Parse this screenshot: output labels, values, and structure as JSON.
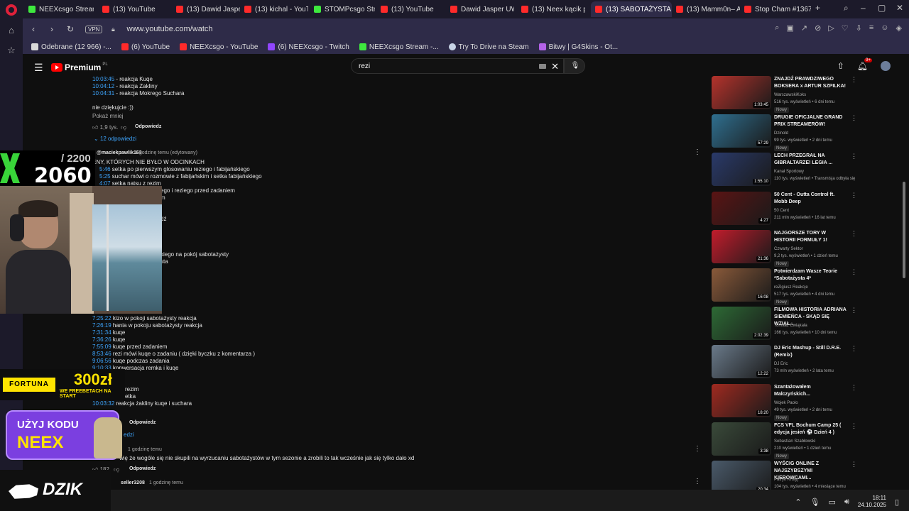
{
  "browser": {
    "tabs": [
      {
        "label": "NEEXcsgo Stream - W",
        "icon": "kick"
      },
      {
        "label": "(13) YouTube",
        "icon": "yt"
      },
      {
        "label": "(13) Dawid Jasper UW",
        "icon": "yt"
      },
      {
        "label": "(13) kichal - YouTube",
        "icon": "yt"
      },
      {
        "label": "STOMPcsgo Strea",
        "icon": "kick"
      },
      {
        "label": "(13) YouTube",
        "icon": "yt"
      },
      {
        "label": "Dawid Jasper UWIEL",
        "icon": "yt"
      },
      {
        "label": "(13) Neex kącik piłka",
        "icon": "yt"
      },
      {
        "label": "(13) SABOTAŻYSTA 4",
        "icon": "yt"
      },
      {
        "label": "(13) Mamm0n– Aman",
        "icon": "yt"
      },
      {
        "label": "Stop Cham #1367 - N",
        "icon": "yt"
      }
    ],
    "new_tab": "+",
    "vpn": "VPN",
    "url": "www.youtube.com/watch",
    "bookmarks": [
      {
        "label": "Odebrane (12 966) -...",
        "icon": "mail"
      },
      {
        "label": "(6) YouTube",
        "icon": "yt"
      },
      {
        "label": "NEEXcsgo - YouTube",
        "icon": "yt"
      },
      {
        "label": "(6) NEEXcsgo - Twitch",
        "icon": "twitch"
      },
      {
        "label": "NEEXcsgo Stream -...",
        "icon": "kick"
      },
      {
        "label": "Try To Drive na Steam",
        "icon": "steam"
      },
      {
        "label": "Bitwy | G4Skins - Ot...",
        "icon": "g4"
      }
    ]
  },
  "youtube": {
    "logo_word": "Premium",
    "logo_region": "PL",
    "search_value": "rezi",
    "notif_count": "9+"
  },
  "comments": {
    "lines_top": [
      {
        "ts": "10:03:45",
        "text": " - reakcja Kuqe"
      },
      {
        "ts": "10:04:12",
        "text": " - reakcja Zakliny"
      },
      {
        "ts": "10:04:31",
        "text": " - reakcja Mokrego Suchara"
      }
    ],
    "body1": "nie dziękujcie :))",
    "show_less": "Pokaż mniej",
    "likes1": "1,9 tys.",
    "reply": "Odpowiedz",
    "replies_toggle": "12 odpowiedzi",
    "author2": "@maciekpawlik163",
    "meta2": "1 godzinę temu (edytowany)",
    "header2": "ENY, KTÓRYCH NIE BYŁO W ODCINKACH",
    "lines_mid": [
      {
        "ts": "5:46",
        "text": " setka po pierwszym glosowaniu reziego i fabijańskiego"
      },
      {
        "ts": "5:25",
        "text": " suchar mówi o rozmowie z fabijańskim i setka fabijańskiego"
      },
      {
        "ts": "4:07",
        "text": " setka natsu z rezim"
      }
    ],
    "frag1": "ego i reziego przed zadaniem",
    "frag2": "m",
    "frag3": "dź",
    "frag4": "kiego na pokój sabotażysty",
    "frag5": "sta",
    "lines_low": [
      {
        "ts": "7:25:22",
        "text": " kizo w pokoji sabotażysty reakcja"
      },
      {
        "ts": "7:26:19",
        "text": " hania w pokoju sabotażysty reakcja"
      },
      {
        "ts": "7:31:34",
        "text": " kuqe"
      },
      {
        "ts": "7:36:26",
        "text": " kuqe"
      },
      {
        "ts": "7:55:09",
        "text": " kuqe przed zadaniem"
      },
      {
        "ts": "8:53:46",
        "text": " rezi mówi kuqe o zadaniu ( dzięki byczku z komentarza )"
      },
      {
        "ts": "9:06:56",
        "text": " kuqe podczas zadania"
      },
      {
        "ts": "9:10:33",
        "text": " konwersacja remka i kuqe"
      }
    ],
    "frag6": "rezim",
    "frag7": "etka",
    "line_last": {
      "ts": "10:03:32",
      "text": " reakcja żakliny kuqe i suchara"
    },
    "reply_b": "Odpowiedz",
    "frag8": "edzi",
    "meta3": "1 godzinę temu",
    "body3": "wię że wogóle się nie skupili na wyrzucaniu sabotażystów w tym sezonie a zrobili to tak wcześnie jak się tylko dało xd",
    "likes3": "182",
    "reply_c": "Odpowiedz",
    "author4": "seller3208",
    "meta4": "1 godzinę temu"
  },
  "overlay": {
    "counter_total": "/ 2200",
    "counter_value": "2060",
    "fortuna_brand": "FORTUNA",
    "fortuna_amount": "300zł",
    "fortuna_note": "WE FREEBETACH NA START",
    "code_line1": "UŻYJ KODU",
    "code_line2": "NEEX",
    "dzik_word": "DZIK"
  },
  "recommendations": [
    {
      "title": "ZNAJDŹ PRAWDZIWEGO BOKSERA x ARTUR SZPILKA!",
      "channel": "WarszawskiKoks",
      "stats": "516 tys. wyświetleń • 6 dni temu",
      "badge": "Nowy",
      "duration": "1:03:45",
      "color": "#b5332c"
    },
    {
      "title": "DRUGIE OFICJALNE GRAND PRIX STREAMERÓW!",
      "channel": "Dzinold",
      "stats": "99 tys. wyświetleń • 2 dni temu",
      "badge": "Nowy",
      "duration": "57:29",
      "color": "#2f6f8f"
    },
    {
      "title": "LECH PRZEGRAŁ NA GIBRALTARZE! LEGIA ...",
      "channel": "Kanał Sportowy",
      "stats": "110 tys. wyświetleń • Transmisja odbyła się",
      "badge": "",
      "duration": "1:55:10",
      "color": "#2a3a6a"
    },
    {
      "title": "50 Cent - Outta Control ft. Mobb Deep",
      "channel": "50 Cent",
      "stats": "211 mln wyświetleń • 16 lat temu",
      "badge": "",
      "duration": "4:27",
      "color": "#5a1414"
    },
    {
      "title": "NAJGORSZE TORY W HISTORII FORMUŁY 1!",
      "channel": "Czwarty Sektor",
      "stats": "9,2 tys. wyświetleń • 1 dzień temu",
      "badge": "Nowy",
      "duration": "21:36",
      "color": "#c21c2c"
    },
    {
      "title": "Potwierdzam Wasze Teorie *Sabotażysta 4*",
      "channel": "reZigiusz Reakcje",
      "stats": "517 tys. wyświetleń • 4 dni temu",
      "badge": "Nowy",
      "duration": "16:08",
      "color": "#8a5a3a"
    },
    {
      "title": "FILMOWA HISTORIA ADRIANA SIEMIEŃCA - SKĄD SIĘ WZIĄŁ...",
      "channel": "Tomasz Ćwiąkała",
      "stats": "166 tys. wyświetleń • 10 dni temu",
      "badge": "",
      "duration": "2:02:39",
      "color": "#2d6a35"
    },
    {
      "title": "DJ Eric Mashup - Still D.R.E. (Remix)",
      "channel": "DJ Eric",
      "stats": "73 mln wyświetleń • 2 lata temu",
      "badge": "",
      "duration": "12:22",
      "color": "#6a7a8a"
    },
    {
      "title": "Szantażowałem Malczyńskich...",
      "channel": "Wojek Paolo",
      "stats": "49 tys. wyświetleń • 2 dni temu",
      "badge": "Nowy",
      "duration": "18:20",
      "color": "#a02a20"
    },
    {
      "title": "FCS VFL Bochum Camp 25 ( edycja jesień ⚽ Dzień 4 )",
      "channel": "Sebastian Szabłowski",
      "stats": "210 wyświetleń • 1 dzień temu",
      "badge": "Nowy",
      "duration": "3:38",
      "color": "#3a4a3a"
    },
    {
      "title": "WYŚCIG ONLINE Z NAJSZYBSZYMI KIEROWCAMI...",
      "channel": "Patryk Krutyj",
      "stats": "104 tys. wyświetleń • 4 miesiące temu",
      "badge": "",
      "duration": "20:34",
      "color": "#4a5a6a"
    }
  ],
  "taskbar": {
    "time": "18:11",
    "date": "24.10.2025"
  }
}
